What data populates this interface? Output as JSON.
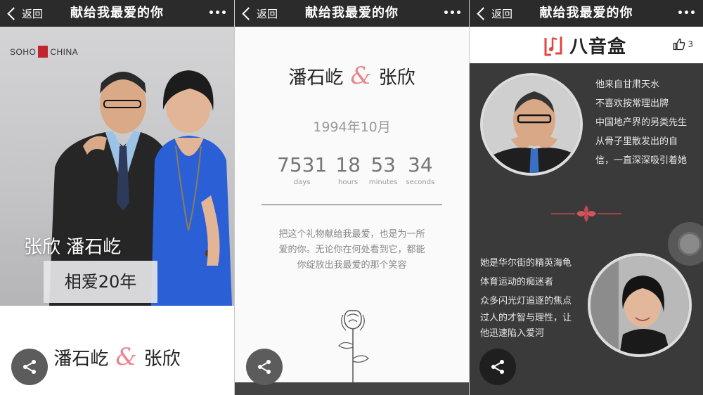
{
  "nav": {
    "back_label": "返回",
    "title": "献给我最爱的你"
  },
  "panel1": {
    "logo_left": "SOHO",
    "logo_right": "CHINA",
    "photo_names": "张欣 潘石屹",
    "love_badge": "相爱20年",
    "couple_left": "潘石屹",
    "amp": "&",
    "couple_right": "张欣"
  },
  "panel2": {
    "couple_left": "潘石屹",
    "amp": "&",
    "couple_right": "张欣",
    "date": "1994年10月",
    "countdown": [
      {
        "value": "7531",
        "label": "days"
      },
      {
        "value": "18",
        "label": "hours"
      },
      {
        "value": "53",
        "label": "minutes"
      },
      {
        "value": "34",
        "label": "seconds"
      }
    ],
    "message": "把这个礼物献给我最爱，也是为一所爱的你。无论你在何处看到它，都能你绽放出我最爱的那个笑容"
  },
  "panel3": {
    "brand": "八音盒",
    "like_count": "3",
    "him_lines": [
      "他来自甘肃天水",
      "不喜欢按常理出牌",
      "中国地产界的另类先生",
      "从骨子里散发出的自",
      "信，一直深深吸引着她"
    ],
    "her_lines": [
      "她是华尔街的精英海龟",
      "体育运动的痴迷者",
      "众多闪光灯追逐的焦点",
      "过人的才智与理性，让",
      "他迅速陷入爱河"
    ]
  },
  "colors": {
    "accent": "#e8868f",
    "topbar": "#2b2b2c",
    "brand_red": "#e2453c",
    "dark_bg": "#3a3a3a"
  },
  "icons": [
    "chevron-left-icon",
    "more-dots-icon",
    "share-icon",
    "thumbs-up-icon",
    "rose-icon",
    "ornament-icon"
  ]
}
